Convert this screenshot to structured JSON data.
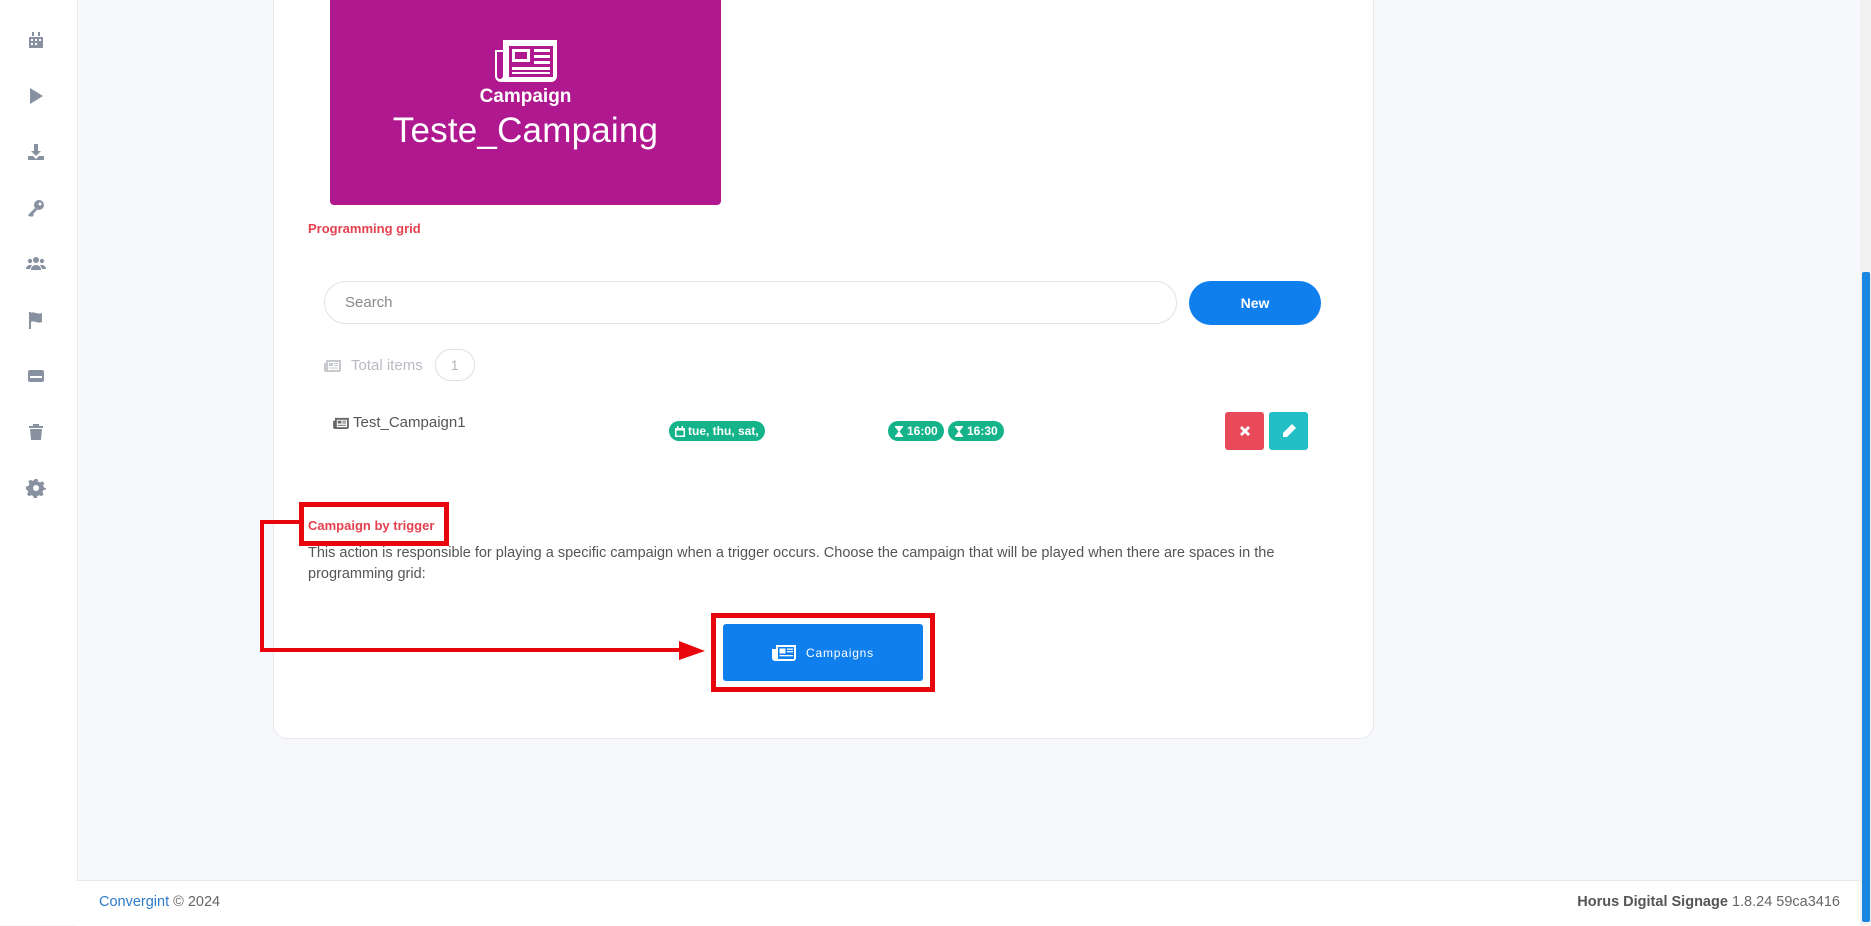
{
  "sidebar": {
    "items": [
      {
        "icon": "calendar-icon"
      },
      {
        "icon": "play-icon"
      },
      {
        "icon": "download-icon"
      },
      {
        "icon": "key-icon"
      },
      {
        "icon": "users-icon"
      },
      {
        "icon": "flag-icon"
      },
      {
        "icon": "device-icon"
      },
      {
        "icon": "trash-icon"
      },
      {
        "icon": "gear-icon"
      }
    ]
  },
  "hero": {
    "icon": "newspaper-icon",
    "label": "Campaign",
    "name": "Teste_Campaing",
    "color": "#b0188f"
  },
  "programming": {
    "title": "Programming grid",
    "search_placeholder": "Search",
    "new_label": "New",
    "total_label": "Total items",
    "total_count": "1",
    "rows": [
      {
        "name": "Test_Campaign1",
        "days": "tue, thu, sat,",
        "start": "16:00",
        "end": "16:30"
      }
    ]
  },
  "trigger": {
    "title": "Campaign by trigger",
    "description": "This action is responsible for playing a specific campaign when a trigger occurs. Choose the campaign that will be played when there are spaces in the programming grid:",
    "button_label": "Campaigns"
  },
  "footer": {
    "brand": "Convergint",
    "copyright": "© 2024",
    "product": "Horus Digital Signage",
    "version": "1.8.24 59ca3416"
  },
  "colors": {
    "accent": "#0f7fee",
    "danger": "#e5404e",
    "success": "#15b38a",
    "edit": "#23bfc7",
    "highlight": "#e8050b"
  }
}
